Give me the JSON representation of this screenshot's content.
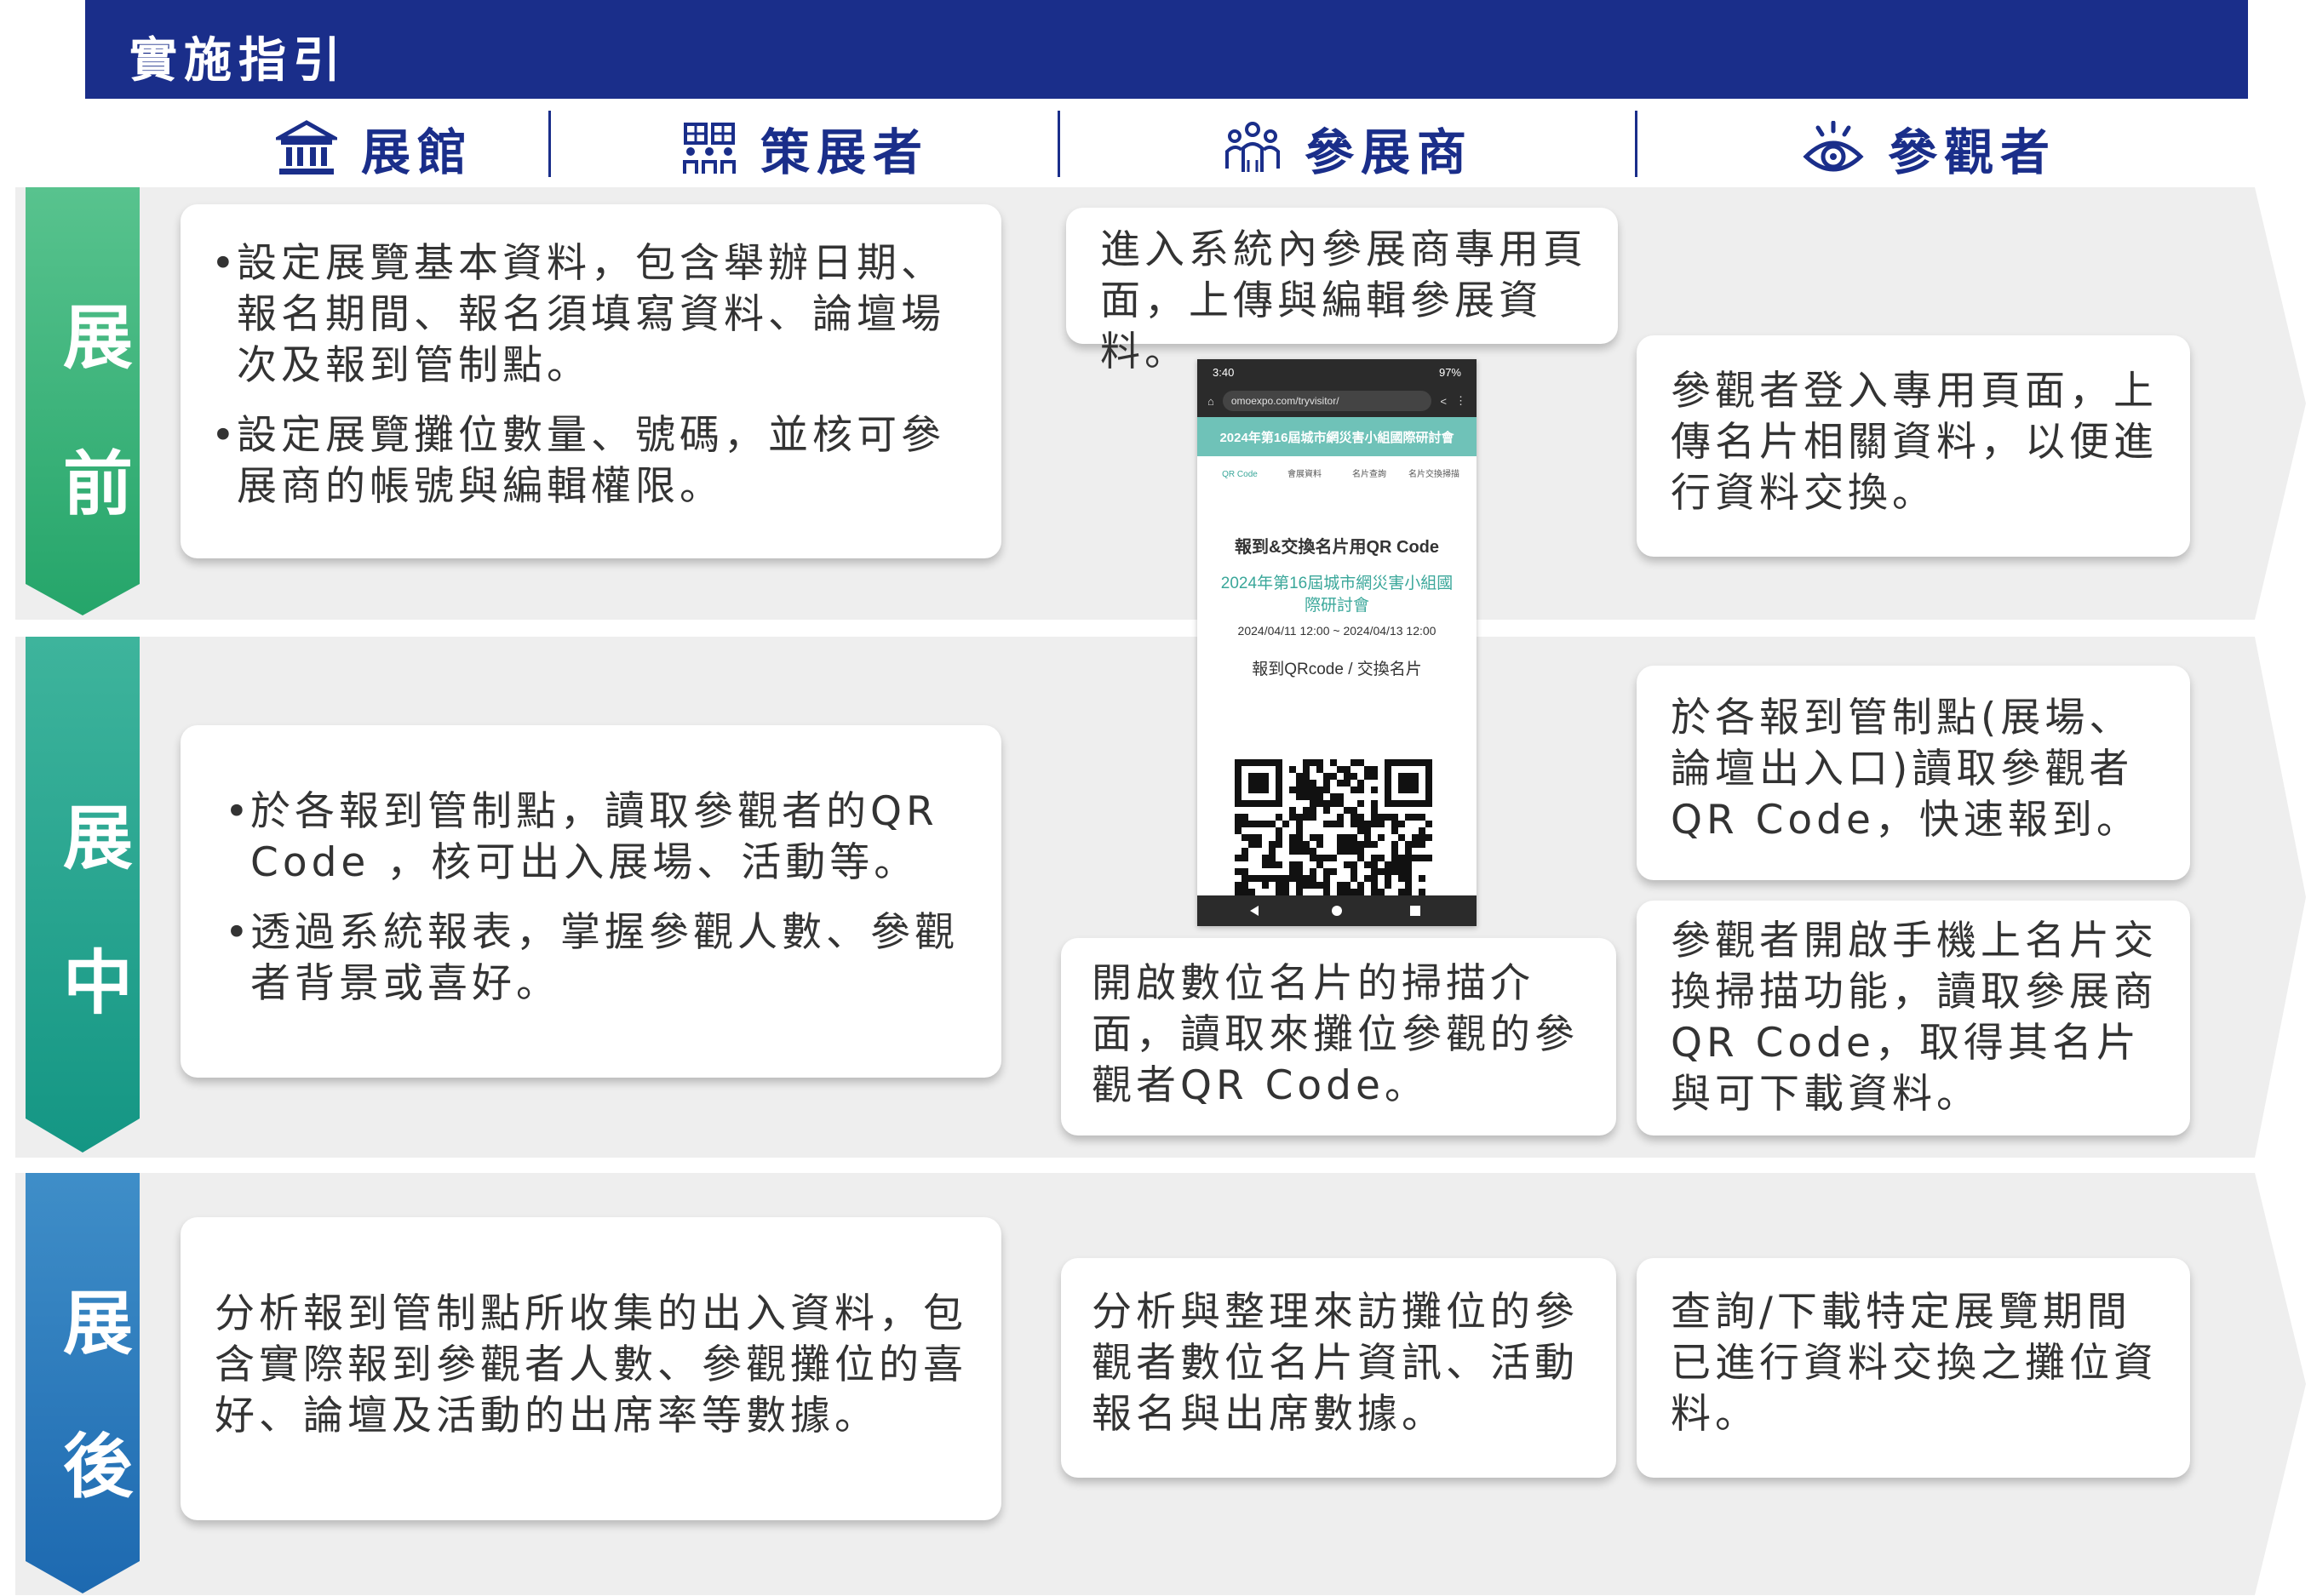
{
  "banner": {
    "title": "實施指引"
  },
  "columns": [
    {
      "label": "展館",
      "icon": "museum-icon"
    },
    {
      "label": "策展者",
      "icon": "curator-group-icon"
    },
    {
      "label": "參展商",
      "icon": "exhibitor-team-icon"
    },
    {
      "label": "參觀者",
      "icon": "eye-icon"
    }
  ],
  "phases": {
    "before": {
      "line1": "展",
      "line2": "前",
      "color_top": "#58c38e",
      "color_bottom": "#25a56a"
    },
    "during": {
      "line1": "展",
      "line2": "中",
      "color_top": "#3eb49c",
      "color_bottom": "#149684"
    },
    "after": {
      "line1": "展",
      "line2": "後",
      "color_top": "#3f8ec8",
      "color_bottom": "#1d69b0"
    }
  },
  "cards": {
    "before_venue": [
      "設定展覽基本資料，包含舉辦日期、報名期間、報名須填寫資料、論壇場次及報到管制點。",
      "設定展覽攤位數量、號碼，並核可參展商的帳號與編輯權限。"
    ],
    "before_exhibitor": "進入系統內參展商專用頁面，上傳與編輯參展資料。",
    "before_visitor": "參觀者登入專用頁面，上傳名片相關資料，以便進行資料交換。",
    "during_venue": [
      "於各報到管制點，讀取參觀者的QR Code ，核可出入展場、活動等。",
      "透過系統報表，掌握參觀人數、參觀者背景或喜好。"
    ],
    "during_exhibitor": "開啟數位名片的掃描介面，讀取來攤位參觀的參觀者QR Code。",
    "during_visitor_1": "於各報到管制點(展場、論壇出入口)讀取參觀者QR Code，快速報到。",
    "during_visitor_2": "參觀者開啟手機上名片交換掃描功能，讀取參展商QR Code，取得其名片與可下載資料。",
    "after_venue": "分析報到管制點所收集的出入資料，包含實際報到參觀者人數、參觀攤位的喜好、論壇及活動的出席率等數據。",
    "after_exhibitor": "分析與整理來訪攤位的參觀者數位名片資訊、活動報名與出席數據。",
    "after_visitor": "查詢/下載特定展覽期間已進行資料交換之攤位資料。"
  },
  "phone": {
    "time": "3:40",
    "battery": "97%",
    "url": "omoexpo.com/tryvisitor/",
    "header": "2024年第16屆城市網災害小組國際研討會",
    "tabs": [
      "QR Code",
      "會展資料",
      "名片查詢",
      "名片交換掃描"
    ],
    "section_title": "報到&交換名片用QR Code",
    "event_name": "2024年第16屆城市網災害小組國際研討會",
    "event_date": "2024/04/11 12:00 ~ 2024/04/13 12:00",
    "qr_caption": "報到QRcode / 交換名片"
  }
}
